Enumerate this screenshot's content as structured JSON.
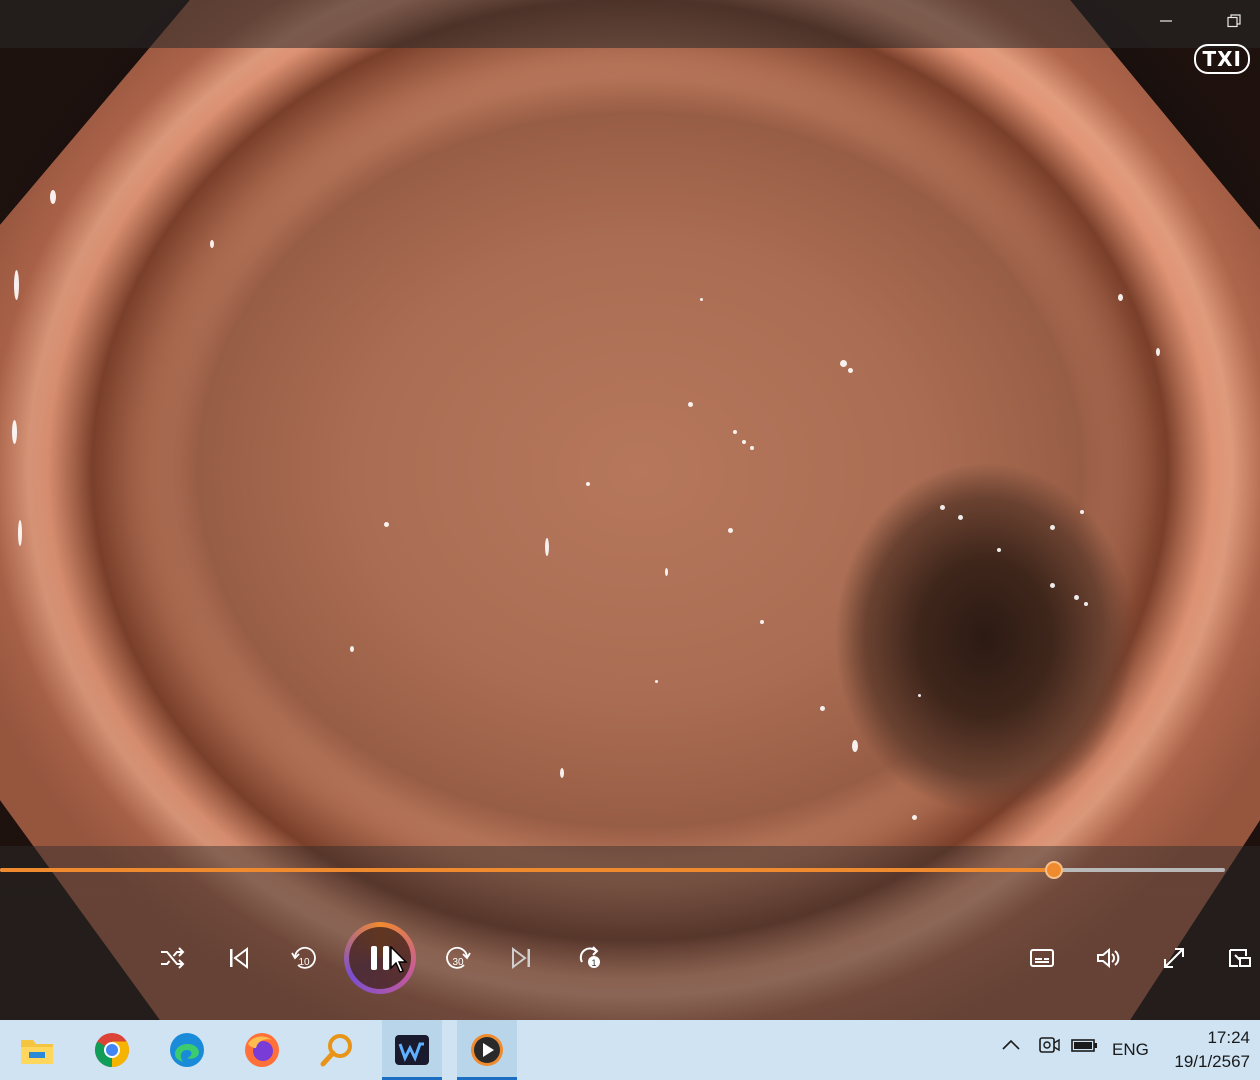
{
  "window": {
    "minimize_icon": "minimize-icon",
    "restore_icon": "restore-icon"
  },
  "video": {
    "overlay_badge": "TXI"
  },
  "player": {
    "progress": 0.86,
    "controls": {
      "shuffle": "shuffle-icon",
      "previous": "previous-track-icon",
      "rewind": "10",
      "play_pause": "pause-icon",
      "forward": "30",
      "next": "next-track-icon",
      "repeat": "1"
    },
    "right_controls": [
      "captions-icon",
      "volume-icon",
      "fullscreen-icon",
      "mini-player-icon"
    ],
    "accent_color": "#f08a2f"
  },
  "taskbar": {
    "apps": [
      "file-explorer-icon",
      "chrome-icon",
      "edge-icon",
      "firefox-icon",
      "search-app-icon",
      "teams-icon",
      "media-player-icon"
    ],
    "language": "ENG",
    "time": "17:24",
    "date": "19/1/2567"
  }
}
